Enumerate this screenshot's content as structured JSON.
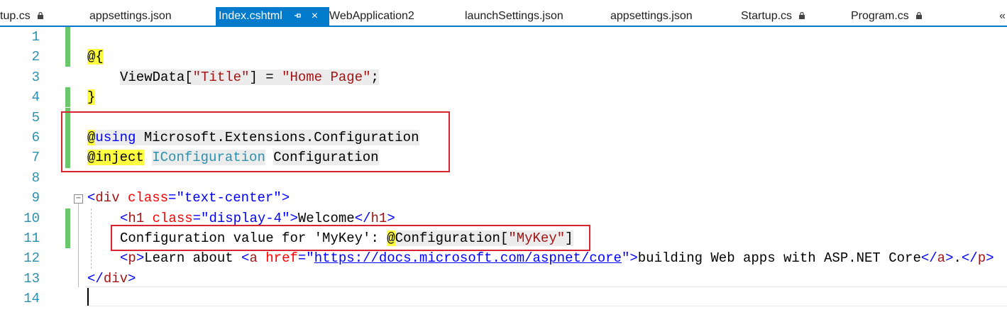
{
  "tabs": [
    {
      "label": "tup.cs",
      "locked": true,
      "active": false
    },
    {
      "label": "appsettings.json",
      "locked": false,
      "active": false
    },
    {
      "label": "Index.cshtml",
      "locked": false,
      "active": true
    },
    {
      "label": "WebApplication2",
      "locked": false,
      "active": false
    },
    {
      "label": "launchSettings.json",
      "locked": false,
      "active": false
    },
    {
      "label": "appsettings.json",
      "locked": false,
      "active": false
    },
    {
      "label": "Startup.cs",
      "locked": true,
      "active": false
    },
    {
      "label": "Program.cs",
      "locked": true,
      "active": false
    }
  ],
  "tab_overflow": "«",
  "active_tab_close": "×",
  "line_numbers": [
    "1",
    "2",
    "3",
    "4",
    "5",
    "6",
    "7",
    "8",
    "9",
    "10",
    "11",
    "12",
    "13",
    "14"
  ],
  "code": {
    "l2_at": "@{",
    "l3_a": "ViewData[",
    "l3_str": "\"Title\"",
    "l3_b": "] = ",
    "l3_val": "\"Home Page\"",
    "l3_c": ";",
    "l4_brace": "}",
    "l6_at": "@",
    "l6_kw": "using",
    "l6_ns": " Microsoft.Extensions.Configuration",
    "l7_at": "@inject",
    "l7_type": "IConfiguration",
    "l7_name": "Configuration",
    "l9_open": "<",
    "l9_tag": "div",
    "l9_attr": " class",
    "l9_eq": "=",
    "l9_val": "\"text-center\"",
    "l9_close": ">",
    "l10_open": "<",
    "l10_tag": "h1",
    "l10_attr": " class",
    "l10_eq": "=",
    "l10_val": "\"display-4\"",
    "l10_close": ">",
    "l10_text": "Welcome",
    "l10_end_open": "</",
    "l10_end_tag": "h1",
    "l10_end_close": ">",
    "l11_text": "Configuration value for 'MyKey': ",
    "l11_at": "@",
    "l11_obj": "Configuration[",
    "l11_key": "\"MyKey\"",
    "l11_end": "]",
    "l12_p_open": "<",
    "l12_p": "p",
    "l12_p_close": ">",
    "l12_text1": "Learn about ",
    "l12_a_open": "<",
    "l12_a": "a",
    "l12_href": " href",
    "l12_eq": "=",
    "l12_q1": "\"",
    "l12_url": "https://docs.microsoft.com/aspnet/core",
    "l12_q2": "\"",
    "l12_a_close": ">",
    "l12_text2": "building Web apps with ASP.NET Core",
    "l12_a_end_open": "</",
    "l12_a_end": "a",
    "l12_a_end_close": ">",
    "l12_dot": ".",
    "l12_p_end_open": "</",
    "l12_p_end": "p",
    "l12_p_end_close": ">",
    "l13_open": "</",
    "l13_tag": "div",
    "l13_close": ">"
  },
  "colors": {
    "accent": "#007acc",
    "highlight_box": "#d9232f",
    "razor_at_bg": "#ffff40",
    "changed_bar": "#6cc76c"
  }
}
